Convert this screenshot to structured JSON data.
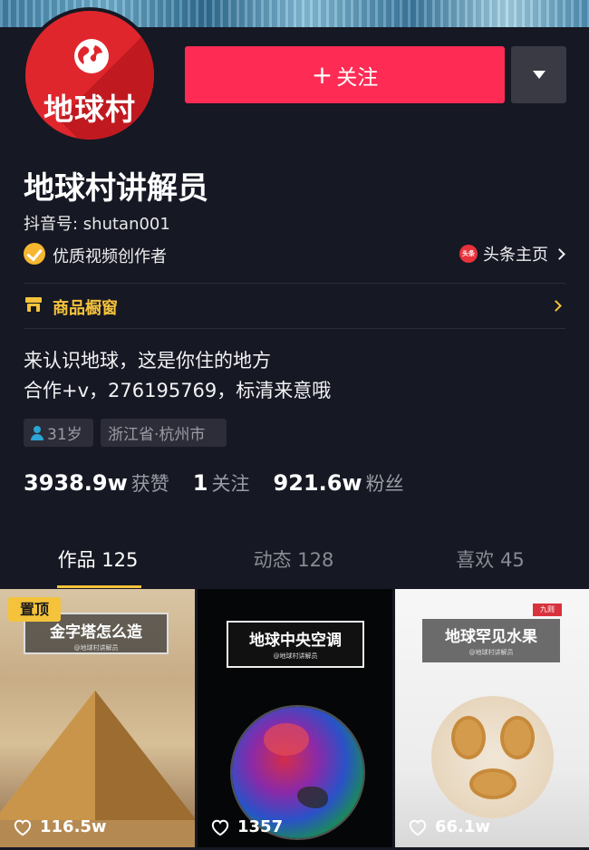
{
  "profile": {
    "avatar_text": "地球村",
    "name": "地球村讲解员",
    "douyin_id": "抖音号: shutan001",
    "badge": "优质视频创作者",
    "toutiao_icon": "头条",
    "toutiao_link": "头条主页",
    "shop": "商品橱窗",
    "bio_line1": "来认识地球，这是你住的地方",
    "bio_line2": "合作+v，276195769，标清来意哦",
    "age_tag": "31岁",
    "location_tag": "浙江省·杭州市"
  },
  "actions": {
    "follow_plus": "+",
    "follow_label": "关注"
  },
  "stats": [
    {
      "value": "3938.9w",
      "label": "获赞"
    },
    {
      "value": "1",
      "label": "关注"
    },
    {
      "value": "921.6w",
      "label": "粉丝"
    }
  ],
  "tabs": [
    {
      "label": "作品 125",
      "active": true
    },
    {
      "label": "动态 128",
      "active": false
    },
    {
      "label": "喜欢 45",
      "active": false
    }
  ],
  "videos": [
    {
      "title": "金字塔怎么造",
      "subtitle": "@地球村讲解员",
      "pin": "置顶",
      "likes": "116.5w"
    },
    {
      "title": "地球中央空调",
      "subtitle": "@地球村讲解员",
      "likes": "1357"
    },
    {
      "title": "地球罕见水果",
      "subtitle": "@地球村讲解员",
      "corner": "九则",
      "likes": "66.1w"
    }
  ],
  "colors": {
    "background": "#161823",
    "follow": "#fe2c55",
    "accent": "#f5c33b",
    "muted": "#9a9ba3"
  },
  "icons": [
    "globe-icon",
    "verified-icon",
    "toutiao-icon",
    "shop-icon",
    "chevron-right-icon",
    "dropdown-icon",
    "person-icon",
    "heart-icon"
  ]
}
